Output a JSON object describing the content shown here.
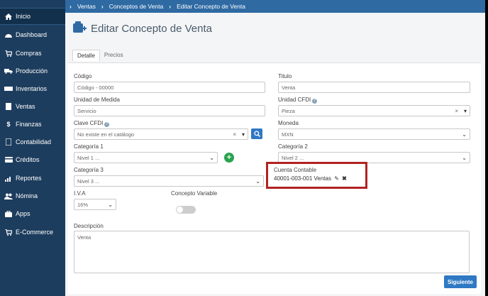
{
  "sidebar": {
    "items": [
      {
        "label": "Inicio",
        "icon": "home-icon"
      },
      {
        "label": "Dashboard",
        "icon": "dashboard-icon"
      },
      {
        "label": "Compras",
        "icon": "cart-icon"
      },
      {
        "label": "Producción",
        "icon": "truck-icon"
      },
      {
        "label": "Inventarios",
        "icon": "inventory-icon"
      },
      {
        "label": "Ventas",
        "icon": "sales-icon"
      },
      {
        "label": "Finanzas",
        "icon": "dollar-icon"
      },
      {
        "label": "Contabilidad",
        "icon": "accounting-icon"
      },
      {
        "label": "Créditos",
        "icon": "credit-card-icon"
      },
      {
        "label": "Reportes",
        "icon": "chart-icon"
      },
      {
        "label": "Nómina",
        "icon": "users-icon"
      },
      {
        "label": "Apps",
        "icon": "briefcase-icon"
      },
      {
        "label": "E-Commerce",
        "icon": "cart-icon"
      }
    ]
  },
  "breadcrumb": [
    "Ventas",
    "Conceptos de Venta",
    "Editar Concepto de Venta"
  ],
  "page": {
    "title": "Editar Concepto de Venta"
  },
  "tabs": [
    "Detalle",
    "Precios"
  ],
  "form": {
    "codigo": {
      "label": "Código",
      "value": "Código - 00000"
    },
    "titulo": {
      "label": "Titulo",
      "value": "Venta"
    },
    "unidad_medida": {
      "label": "Unidad de Medida",
      "value": "Servicio"
    },
    "unidad_cfdi": {
      "label": "Unidad CFDI",
      "value": "Pieza"
    },
    "clave_cfdi": {
      "label": "Clave CFDI",
      "value": "No existe en el catálogo"
    },
    "moneda": {
      "label": "Moneda",
      "value": "MXN"
    },
    "categoria1": {
      "label": "Categoría 1",
      "value": "Nivel 1 ..."
    },
    "categoria2": {
      "label": "Categoría 2",
      "value": "Nivel 2 ..."
    },
    "categoria3": {
      "label": "Categoría 3",
      "value": "Nivel 3 ..."
    },
    "cuenta_contable": {
      "label": "Cuenta Contable",
      "value": "40001-003-001 Ventas"
    },
    "iva": {
      "label": "I.V.A",
      "value": "16%"
    },
    "concepto_variable": {
      "label": "Concepto Variable"
    },
    "descripcion": {
      "label": "Descripción",
      "value": "Venta"
    }
  },
  "buttons": {
    "submit": "Siguiente"
  },
  "colors": {
    "sidebar": "#1d3d5e",
    "topbar": "#2f6aa3",
    "primary": "#2f78c4",
    "highlight": "#b22222",
    "add": "#2aa34f"
  }
}
